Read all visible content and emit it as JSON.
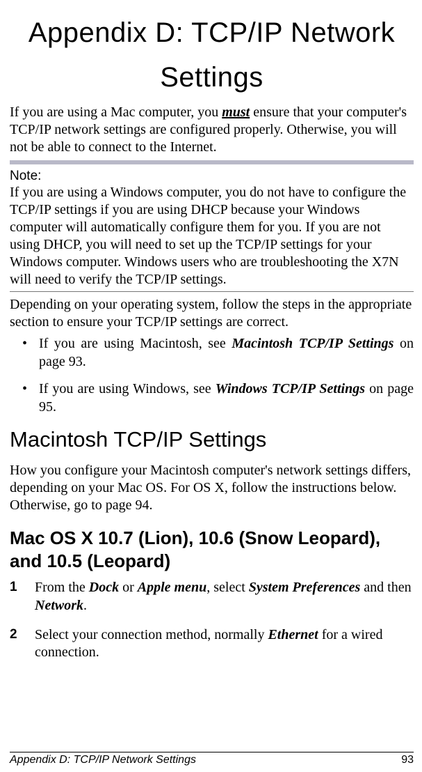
{
  "title": "Appendix D: TCP/IP Network Settings",
  "intro": {
    "pre": "If you are using a Mac computer, you ",
    "must": "must",
    "post": " ensure that your computer's TCP/IP network settings are configured properly. Otherwise, you will not be able to connect to the Internet."
  },
  "note": {
    "label": "Note:",
    "body": "If you are using a Windows computer, you do not have to configure the TCP/IP settings if you are using DHCP because your Windows computer will automatically configure them for you. If you are not using DHCP, you will need to set up the TCP/IP settings for your Windows computer.  Windows users who are troubleshooting the X7N will need to verify the TCP/IP settings."
  },
  "depending": "Depending on your operating system, follow the steps in the appropriate section to ensure your TCP/IP settings are correct.",
  "bullets": [
    {
      "pre": "If you are using Macintosh, see ",
      "bold": "Macintosh TCP/IP Settings",
      "post": " on page 93."
    },
    {
      "pre": "If you are using Windows, see ",
      "bold": "Windows TCP/IP Settings",
      "post": " on page 95."
    }
  ],
  "section_heading": "Macintosh TCP/IP Settings",
  "section_body": "How you configure your Macintosh computer's network settings differs, depending on your Mac OS. For OS X, follow the instructions below. Otherwise, go to page 94.",
  "subsection_heading": "Mac OS X 10.7 (Lion), 10.6 (Snow Leopard), and 10.5 (Leopard)",
  "steps": [
    {
      "parts": [
        {
          "t": "From the "
        },
        {
          "t": "Dock",
          "b": true
        },
        {
          "t": " or "
        },
        {
          "t": "Apple menu",
          "b": true
        },
        {
          "t": ", select "
        },
        {
          "t": "System Preferences",
          "b": true
        },
        {
          "t": " and then "
        },
        {
          "t": "Network",
          "b": true
        },
        {
          "t": "."
        }
      ]
    },
    {
      "parts": [
        {
          "t": "Select your connection method, normally "
        },
        {
          "t": "Ethernet",
          "b": true
        },
        {
          "t": " for a wired connection."
        }
      ]
    }
  ],
  "footer": {
    "left": "Appendix D: TCP/IP Network Settings",
    "page": "93"
  }
}
